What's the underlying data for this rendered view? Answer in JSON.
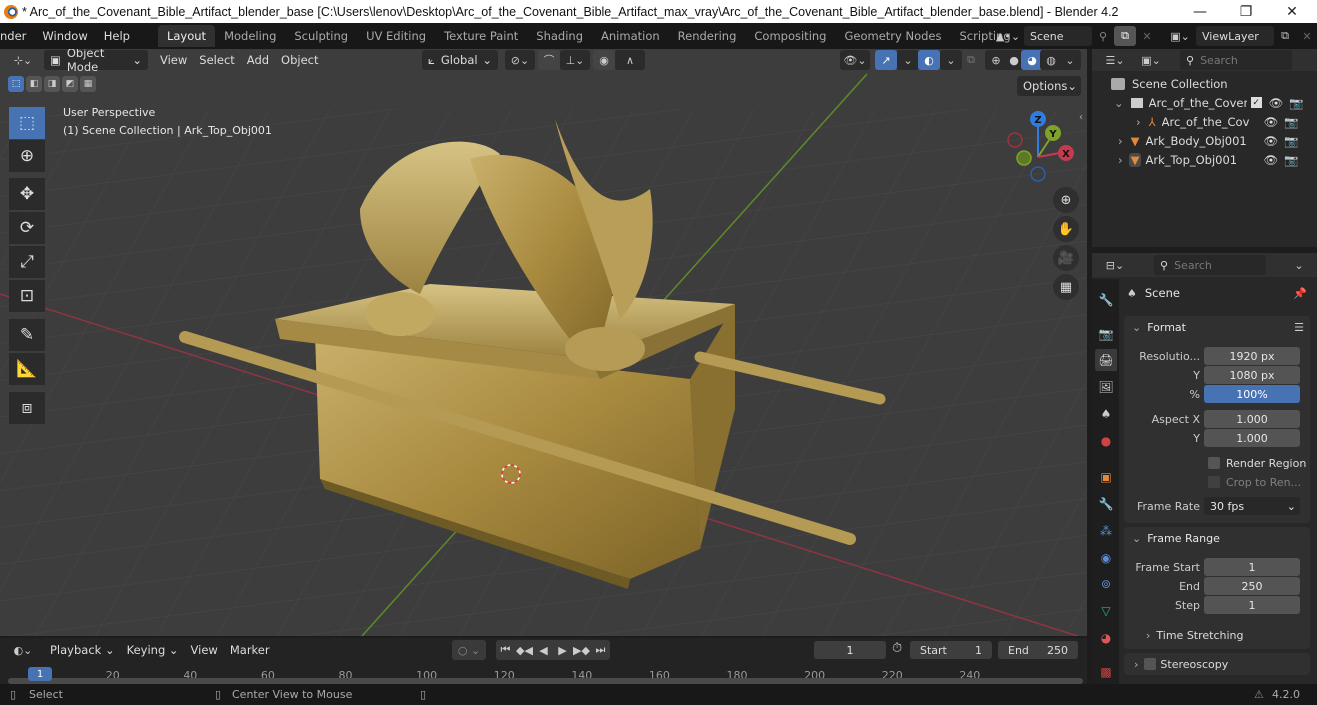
{
  "window": {
    "title": "* Arc_of_the_Covenant_Bible_Artifact_blender_base [C:\\Users\\lenov\\Desktop\\Arc_of_the_Covenant_Bible_Artifact_max_vray\\Arc_of_the_Covenant_Bible_Artifact_blender_base.blend] - Blender 4.2",
    "minimize": "—",
    "maximize": "❐",
    "close": "✕"
  },
  "menu": [
    "nder",
    "Window",
    "Help"
  ],
  "workspaces": [
    {
      "label": "Layout",
      "active": true
    },
    {
      "label": "Modeling"
    },
    {
      "label": "Sculpting"
    },
    {
      "label": "UV Editing"
    },
    {
      "label": "Texture Paint"
    },
    {
      "label": "Shading"
    },
    {
      "label": "Animation"
    },
    {
      "label": "Rendering"
    },
    {
      "label": "Compositing"
    },
    {
      "label": "Geometry Nodes"
    },
    {
      "label": "Scripting"
    }
  ],
  "add_workspace": "+",
  "scene_selector": {
    "value": "Scene"
  },
  "viewlayer_selector": {
    "value": "ViewLayer"
  },
  "viewport": {
    "mode": "Object Mode",
    "menus": [
      "View",
      "Select",
      "Add",
      "Object"
    ],
    "transform_orientation": "Global",
    "options_label": "Options",
    "overlay_text": {
      "perspective": "User Perspective",
      "collection": "(1) Scene Collection | Ark_Top_Obj001"
    },
    "gizmo_axes": {
      "x": "X",
      "y": "Y",
      "z": "Z"
    },
    "colors": {
      "x_axis": "#c8394e",
      "y_axis": "#7ea32a",
      "z_axis": "#2f7de0",
      "active_blue": "#4772b3"
    },
    "tools": [
      "select-box",
      "cursor",
      "move",
      "rotate",
      "scale",
      "transform",
      "annotate",
      "measure",
      "add-cube"
    ]
  },
  "outliner": {
    "search_placeholder": "Search",
    "items": [
      {
        "label": "Scene Collection",
        "type": "scene-collection"
      },
      {
        "label": "Arc_of_the_Covena",
        "type": "collection"
      },
      {
        "label": "Arc_of_the_Cov",
        "type": "empty"
      },
      {
        "label": "Ark_Body_Obj001",
        "type": "mesh"
      },
      {
        "label": "Ark_Top_Obj001",
        "type": "mesh"
      }
    ]
  },
  "properties": {
    "search_placeholder": "Search",
    "context": "Scene",
    "format": {
      "title": "Format",
      "resolution_label": "Resolutio...",
      "resolution_x": "1920 px",
      "y_label": "Y",
      "resolution_y": "1080 px",
      "percent_label": "%",
      "percent": "100%",
      "aspect_x_label": "Aspect X",
      "aspect_x": "1.000",
      "aspect_y_label": "Y",
      "aspect_y": "1.000",
      "render_region": "Render Region",
      "crop": "Crop to Ren...",
      "frame_rate_label": "Frame Rate",
      "frame_rate": "30 fps"
    },
    "frame_range": {
      "title": "Frame Range",
      "start_label": "Frame Start",
      "start": "1",
      "end_label": "End",
      "end": "250",
      "step_label": "Step",
      "step": "1",
      "time_stretching": "Time Stretching"
    },
    "stereoscopy": "Stereoscopy"
  },
  "timeline": {
    "menus": [
      "Playback",
      "Keying",
      "View",
      "Marker"
    ],
    "current_frame": "1",
    "start_label": "Start",
    "start": "1",
    "end_label": "End",
    "end": "250",
    "ticks": [
      "20",
      "40",
      "60",
      "80",
      "100",
      "120",
      "140",
      "160",
      "180",
      "200",
      "220",
      "240"
    ],
    "playhead": "1"
  },
  "statusbar": {
    "select": "Select",
    "center_view": "Center View to Mouse",
    "version": "4.2.0"
  }
}
